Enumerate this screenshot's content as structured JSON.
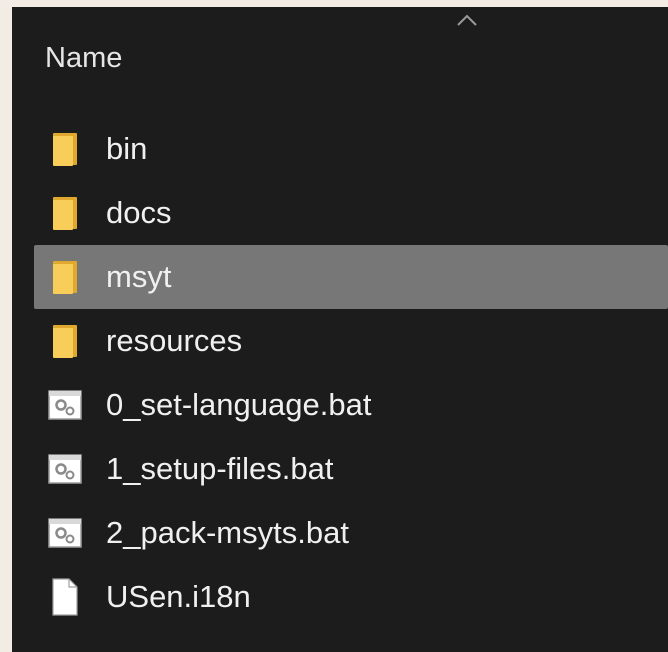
{
  "header": {
    "name_label": "Name",
    "sort_icon": "chevron-up-icon"
  },
  "files": [
    {
      "name": "bin",
      "type": "folder",
      "icon": "folder-icon",
      "selected": false
    },
    {
      "name": "docs",
      "type": "folder",
      "icon": "folder-icon",
      "selected": false
    },
    {
      "name": "msyt",
      "type": "folder",
      "icon": "folder-icon",
      "selected": true
    },
    {
      "name": "resources",
      "type": "folder",
      "icon": "folder-icon",
      "selected": false
    },
    {
      "name": "0_set-language.bat",
      "type": "batch",
      "icon": "batch-file-icon",
      "selected": false
    },
    {
      "name": "1_setup-files.bat",
      "type": "batch",
      "icon": "batch-file-icon",
      "selected": false
    },
    {
      "name": "2_pack-msyts.bat",
      "type": "batch",
      "icon": "batch-file-icon",
      "selected": false
    },
    {
      "name": "USen.i18n",
      "type": "file",
      "icon": "file-icon",
      "selected": false
    }
  ],
  "colors": {
    "background": "#1c1c1c",
    "selection": "#777777",
    "folder": "#f5c24a",
    "text": "#f0f0f0"
  }
}
